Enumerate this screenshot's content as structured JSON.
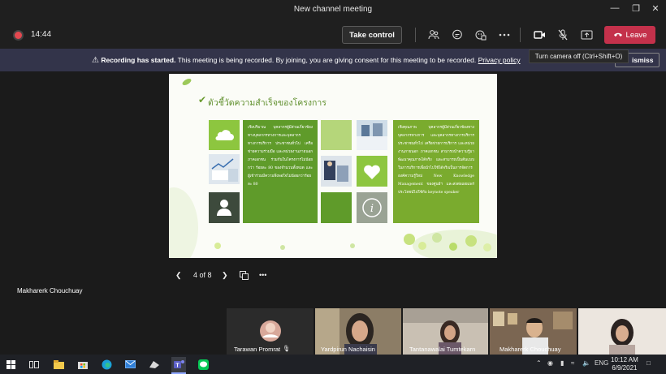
{
  "window": {
    "title": "New channel meeting"
  },
  "toolbar": {
    "timer": "14:44",
    "take_control": "Take control",
    "leave": "Leave"
  },
  "banner": {
    "bold": "Recording has started.",
    "text": "This meeting is being recorded. By joining, you are giving consent for this meeting to be recorded.",
    "link": "Privacy policy",
    "dismiss": "ismiss"
  },
  "tooltip": "Turn camera off (Ctrl+Shift+O)",
  "slide": {
    "title": "ตัวชี้วัดความสำเร็จของโครงการ",
    "text_left": "เชิงปริมาณ บุคลากรผู้มีส่วนเกี่ยวข้องทางบุคลากรทางการและบุคลากรทางการบริการ ประชาชนทั่วไป เครือข่ายความร่วมมือ และหน่วยงานภายนอก ภาคเอกชน ร่วมกันในโครงการไม่น้อยกว่า ร้อยละ 80 ของจำนวนทั้งหมด และผู้เข้าร่วมมีความพึงพอใจไม่น้อยกว่าร้อยละ 80",
    "text_right": "เชิงคุณภาพ บุคลากรผู้มีส่วนเกี่ยวข้องทางบุคลากรทางการ และบุคลากรทางการบริการ ประชาชนทั่วไป เครือข่ายการบริการ และหน่วยงานภายนอก ภาคเอกชน สามารถนำความรู้มาพัฒนาคุณภาพได้จริง และสามารถเป็นต้นแบบในการบริการเพื่อนำไปใช้ได้จริงเป็นการจัดการองค์ความรู้ใหม่ New Knowledge Management ของศูนย์ฯ และส่งต่อเผยแพร่ประโยชน์ไปใช้กับ keynote speaker"
  },
  "slide_nav": {
    "page": "4 of 8"
  },
  "presenter": "Makharerk Chouchuay",
  "participants": [
    "Tarawan Promrat",
    "Yardpirun Nachaisin",
    "Tantanawalai Tumtekarn",
    "Makharerk Chouchuay"
  ],
  "taskbar": {
    "lang": "ENG",
    "time": "10:12 AM",
    "date": "6/9/2021"
  },
  "colors": {
    "accent_green": "#7aab2e",
    "leave_red": "#c4314b",
    "banner": "#33344a"
  }
}
